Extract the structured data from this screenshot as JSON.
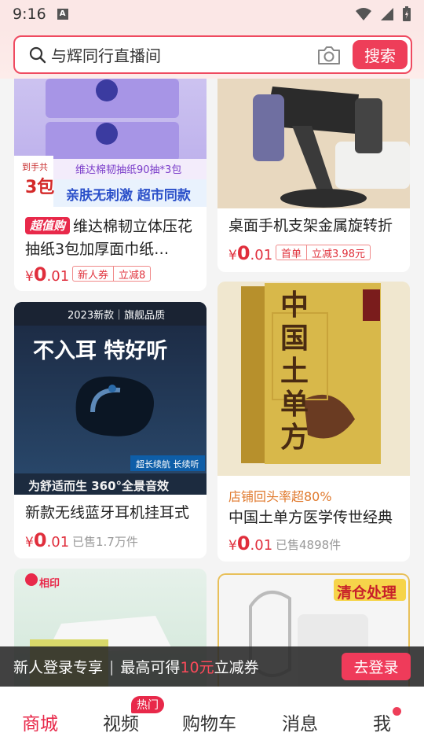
{
  "status_bar": {
    "time": "9:16",
    "notification_icon": "a-icon",
    "wifi_icon": "wifi-icon",
    "signal_icon": "signal-icon",
    "battery_icon": "battery-icon"
  },
  "search": {
    "query": "与辉同行直播间",
    "button_label": "搜索",
    "search_icon": "search-icon",
    "camera_icon": "camera-icon"
  },
  "products": [
    {
      "title": "维达棉韧立体压花抽纸3包加厚面巾纸…",
      "badge": "超值购",
      "currency": "¥",
      "price_int": "0",
      "price_dec": ".01",
      "tags": [
        "新人券",
        "立减8"
      ],
      "image_texts": [
        "维达棉韧抽纸90抽*3包",
        "亲肤无刺激 超市同款",
        "到手共",
        "3包"
      ]
    },
    {
      "title": "桌面手机支架金属旋转折",
      "currency": "¥",
      "price_int": "0",
      "price_dec": ".01",
      "tags": [
        "首单",
        "立减3.98元"
      ]
    },
    {
      "title": "新款无线蓝牙耳机挂耳式",
      "currency": "¥",
      "price_int": "0",
      "price_dec": ".01",
      "sold": "已售1.7万件",
      "image_texts": [
        "2023新款｜旗舰品质",
        "不入耳 特好听",
        "超长续航 长续听",
        "为舒适而生  360°全景音效"
      ]
    },
    {
      "title": "中国土单方医学传世经典",
      "shop_tip": "店铺回头率超80%",
      "currency": "¥",
      "price_int": "0",
      "price_dec": ".01",
      "sold": "已售4898件",
      "image_texts": [
        "中国土单方"
      ]
    },
    {
      "title": "",
      "image_texts": [
        "相印"
      ]
    },
    {
      "title": "",
      "image_texts": [
        "清仓处理"
      ]
    }
  ],
  "promo": {
    "text_a": "新人登录专享",
    "text_b": "最高可得",
    "amount": "10元",
    "text_c": "立减券",
    "login_label": "去登录"
  },
  "tabbar": {
    "items": [
      "商城",
      "视频",
      "购物车",
      "消息",
      "我"
    ],
    "hot_badge": "热门"
  },
  "colors": {
    "accent": "#e8294a",
    "price": "#e02e3c"
  }
}
